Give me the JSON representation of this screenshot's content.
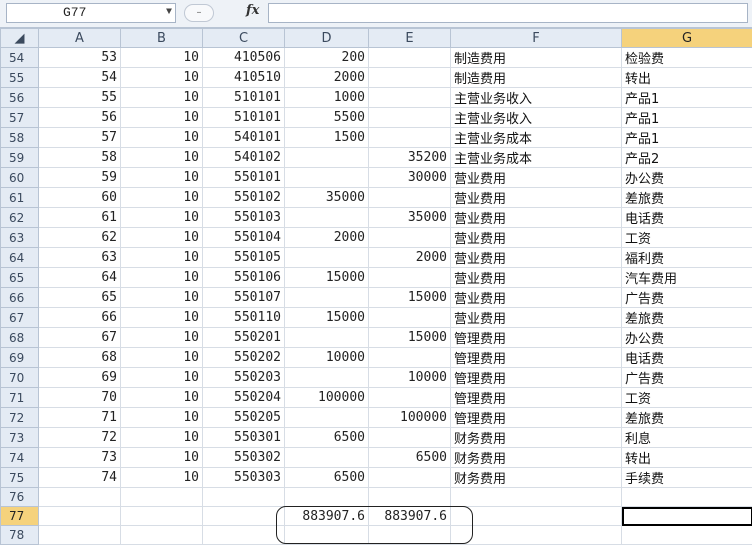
{
  "name_box": "G77",
  "fx_label": "fx",
  "columns": [
    "A",
    "B",
    "C",
    "D",
    "E",
    "F",
    "G"
  ],
  "rows": [
    {
      "r": "54",
      "a": "53",
      "b": "10",
      "c": "410506",
      "d": "200",
      "e": "",
      "f": "制造费用",
      "g": "检验费"
    },
    {
      "r": "55",
      "a": "54",
      "b": "10",
      "c": "410510",
      "d": "2000",
      "e": "",
      "f": "制造费用",
      "g": "转出"
    },
    {
      "r": "56",
      "a": "55",
      "b": "10",
      "c": "510101",
      "d": "1000",
      "e": "",
      "f": "主营业务收入",
      "g": "产品1"
    },
    {
      "r": "57",
      "a": "56",
      "b": "10",
      "c": "510101",
      "d": "5500",
      "e": "",
      "f": "主营业务收入",
      "g": "产品1"
    },
    {
      "r": "58",
      "a": "57",
      "b": "10",
      "c": "540101",
      "d": "1500",
      "e": "",
      "f": "主营业务成本",
      "g": "产品1"
    },
    {
      "r": "59",
      "a": "58",
      "b": "10",
      "c": "540102",
      "d": "",
      "e": "35200",
      "f": "主营业务成本",
      "g": "产品2"
    },
    {
      "r": "60",
      "a": "59",
      "b": "10",
      "c": "550101",
      "d": "",
      "e": "30000",
      "f": "营业费用",
      "g": "办公费"
    },
    {
      "r": "61",
      "a": "60",
      "b": "10",
      "c": "550102",
      "d": "35000",
      "e": "",
      "f": "营业费用",
      "g": "差旅费"
    },
    {
      "r": "62",
      "a": "61",
      "b": "10",
      "c": "550103",
      "d": "",
      "e": "35000",
      "f": "营业费用",
      "g": "电话费"
    },
    {
      "r": "63",
      "a": "62",
      "b": "10",
      "c": "550104",
      "d": "2000",
      "e": "",
      "f": "营业费用",
      "g": "工资"
    },
    {
      "r": "64",
      "a": "63",
      "b": "10",
      "c": "550105",
      "d": "",
      "e": "2000",
      "f": "营业费用",
      "g": "福利费"
    },
    {
      "r": "65",
      "a": "64",
      "b": "10",
      "c": "550106",
      "d": "15000",
      "e": "",
      "f": "营业费用",
      "g": "汽车费用"
    },
    {
      "r": "66",
      "a": "65",
      "b": "10",
      "c": "550107",
      "d": "",
      "e": "15000",
      "f": "营业费用",
      "g": "广告费"
    },
    {
      "r": "67",
      "a": "66",
      "b": "10",
      "c": "550110",
      "d": "15000",
      "e": "",
      "f": "营业费用",
      "g": "差旅费"
    },
    {
      "r": "68",
      "a": "67",
      "b": "10",
      "c": "550201",
      "d": "",
      "e": "15000",
      "f": "管理费用",
      "g": "办公费"
    },
    {
      "r": "69",
      "a": "68",
      "b": "10",
      "c": "550202",
      "d": "10000",
      "e": "",
      "f": "管理费用",
      "g": "电话费"
    },
    {
      "r": "70",
      "a": "69",
      "b": "10",
      "c": "550203",
      "d": "",
      "e": "10000",
      "f": "管理费用",
      "g": "广告费"
    },
    {
      "r": "71",
      "a": "70",
      "b": "10",
      "c": "550204",
      "d": "100000",
      "e": "",
      "f": "管理费用",
      "g": "工资"
    },
    {
      "r": "72",
      "a": "71",
      "b": "10",
      "c": "550205",
      "d": "",
      "e": "100000",
      "f": "管理费用",
      "g": "差旅费"
    },
    {
      "r": "73",
      "a": "72",
      "b": "10",
      "c": "550301",
      "d": "6500",
      "e": "",
      "f": "财务费用",
      "g": "利息"
    },
    {
      "r": "74",
      "a": "73",
      "b": "10",
      "c": "550302",
      "d": "",
      "e": "6500",
      "f": "财务费用",
      "g": "转出"
    },
    {
      "r": "75",
      "a": "74",
      "b": "10",
      "c": "550303",
      "d": "6500",
      "e": "",
      "f": "财务费用",
      "g": "手续费"
    },
    {
      "r": "76",
      "a": "",
      "b": "",
      "c": "",
      "d": "",
      "e": "",
      "f": "",
      "g": ""
    },
    {
      "r": "77",
      "a": "",
      "b": "",
      "c": "",
      "d": "883907.6",
      "e": "883907.6",
      "f": "",
      "g": ""
    },
    {
      "r": "78",
      "a": "",
      "b": "",
      "c": "",
      "d": "",
      "e": "",
      "f": "",
      "g": ""
    }
  ]
}
